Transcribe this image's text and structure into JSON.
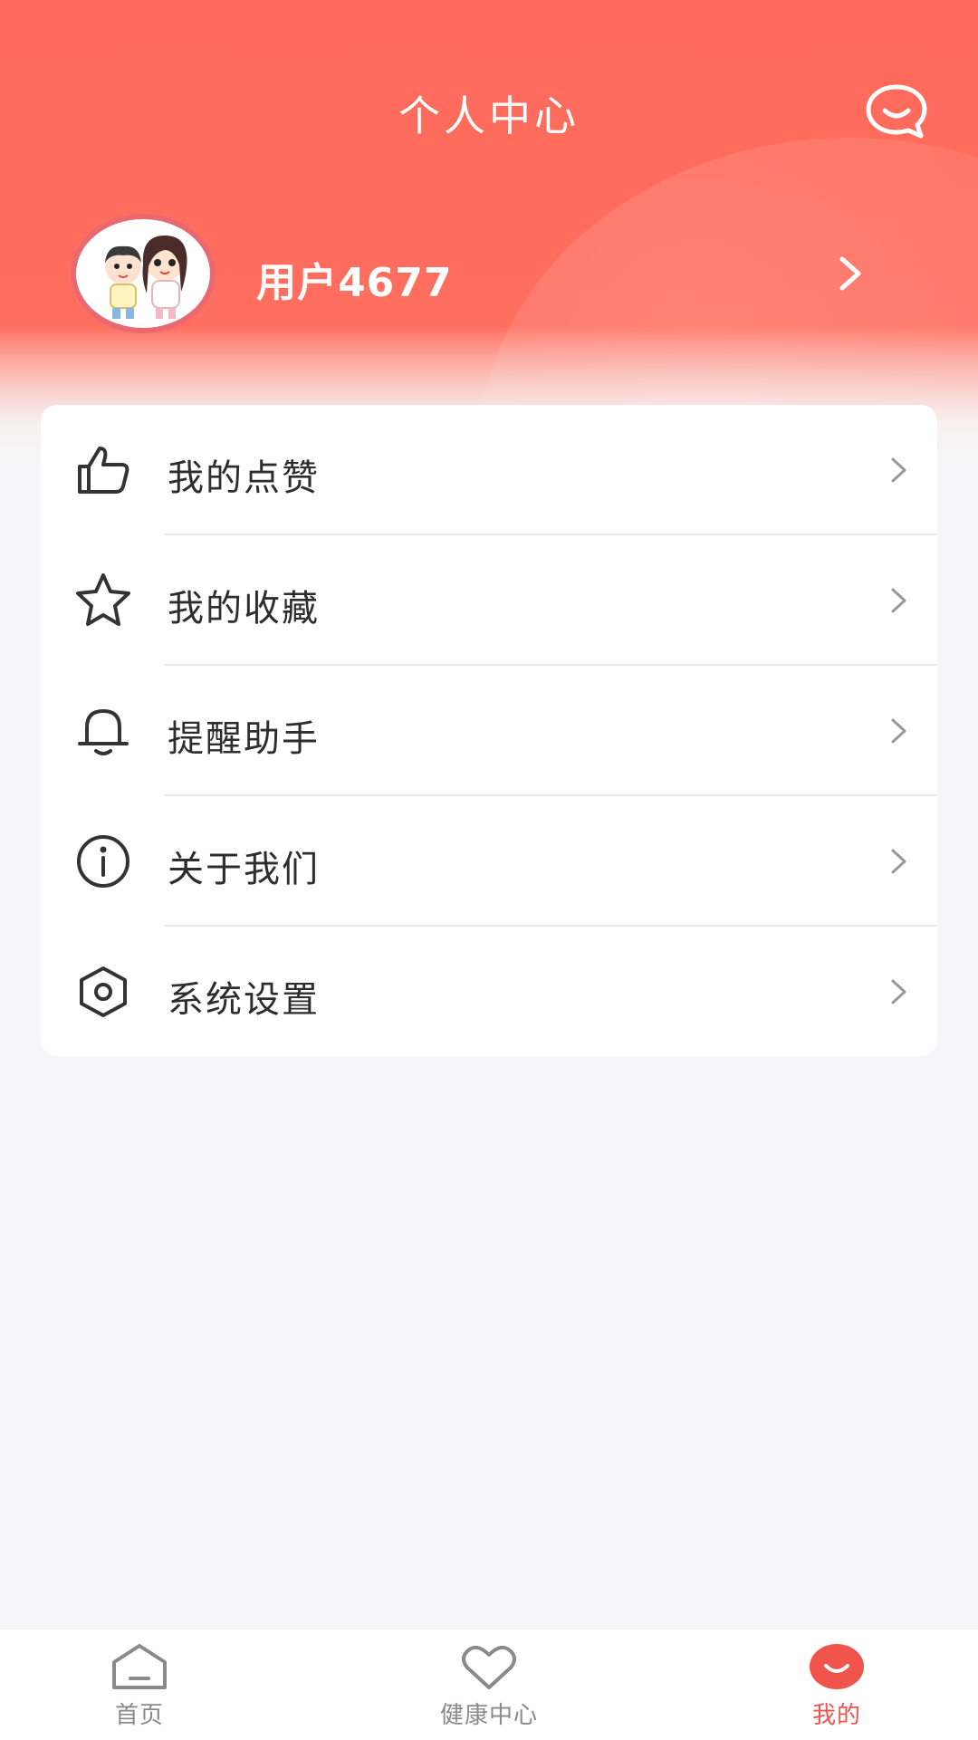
{
  "header": {
    "title": "个人中心",
    "chat_icon": "chat-bubble-icon",
    "gradient_top": "#ff6a5a"
  },
  "profile": {
    "username": "用户4677",
    "avatar_icon": "avatar-cartoon-couple",
    "chevron_icon": "chevron-right-icon"
  },
  "menu": {
    "items": [
      {
        "label": "我的点赞",
        "icon": "thumbs-up-icon"
      },
      {
        "label": "我的收藏",
        "icon": "star-icon"
      },
      {
        "label": "提醒助手",
        "icon": "bell-icon"
      },
      {
        "label": "关于我们",
        "icon": "info-icon"
      },
      {
        "label": "系统设置",
        "icon": "settings-hexagon-icon"
      }
    ]
  },
  "tabbar": {
    "tabs": [
      {
        "label": "首页",
        "icon": "home-icon",
        "active": false
      },
      {
        "label": "健康中心",
        "icon": "heart-icon",
        "active": false
      },
      {
        "label": "我的",
        "icon": "smile-icon",
        "active": true
      }
    ],
    "active_color": "#f0544b",
    "inactive_color": "#8a8a8a"
  }
}
